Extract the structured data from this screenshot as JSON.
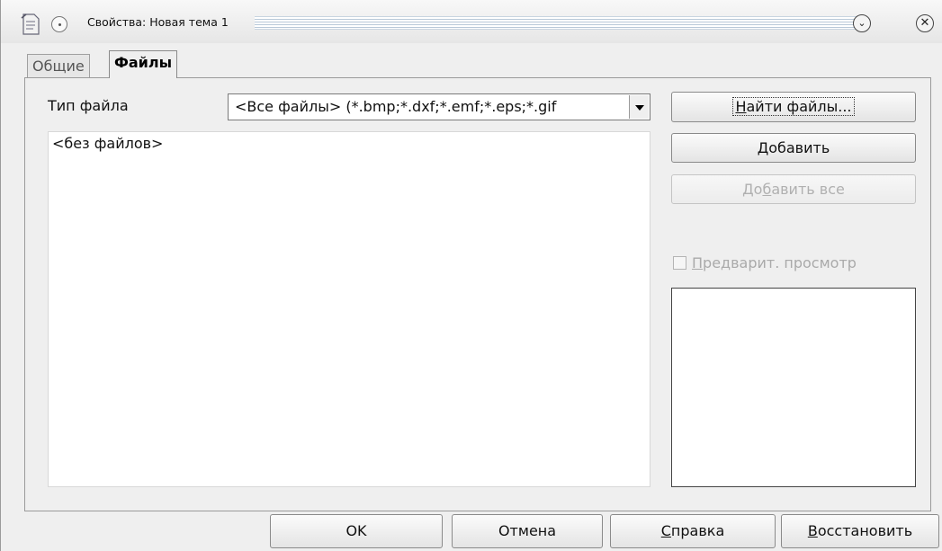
{
  "window": {
    "title": "Свойства: Новая тема 1",
    "app_icon": "document-icon",
    "menu_icon": "window-menu-icon",
    "minimize_icon": "chevron-down-icon",
    "close_icon": "close-icon"
  },
  "tabs": [
    {
      "label": "Общие",
      "active": false
    },
    {
      "label": "Файлы",
      "active": true
    }
  ],
  "files": {
    "file_type_label": "Тип файла",
    "file_type_value": "<Все файлы> (*.bmp;*.dxf;*.emf;*.eps;*.gif",
    "list_empty_text": "<без файлов>",
    "find_files_button": {
      "label_pre": "",
      "label_ul": "Н",
      "label_post": "айти файлы..."
    },
    "add_button": {
      "label_pre": "",
      "label_ul": "Д",
      "label_post": "обавить"
    },
    "add_all_button": {
      "label_pre": "До",
      "label_ul": "б",
      "label_post": "авить все",
      "enabled": false
    },
    "preview_checkbox": {
      "label_pre": "",
      "label_ul": "П",
      "label_post": "редварит. просмотр",
      "checked": false,
      "enabled": false
    }
  },
  "buttons": {
    "ok": "OK",
    "cancel": "Отмена",
    "help": {
      "label_pre": "",
      "label_ul": "С",
      "label_post": "правка"
    },
    "reset": {
      "label_pre": "",
      "label_ul": "В",
      "label_post": "осстановить"
    }
  }
}
